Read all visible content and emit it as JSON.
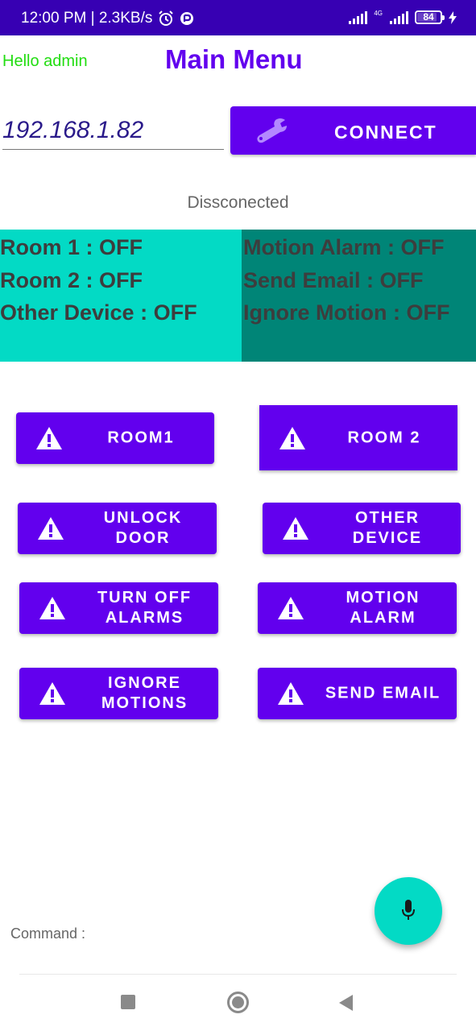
{
  "status_bar": {
    "time_speed": "12:00 PM | 2.3KB/s",
    "net_label": "4G",
    "battery": "84"
  },
  "header": {
    "greeting": "Hello admin",
    "title": "Main Menu"
  },
  "connection": {
    "ip_value": "192.168.1.82",
    "connect_label": "CONNECT",
    "status": "Dissconected"
  },
  "states": {
    "left": [
      "Room 1 : OFF",
      "Room 2 : OFF",
      "Other Device : OFF"
    ],
    "right": [
      "Motion Alarm : OFF",
      "Send Email : OFF",
      "Ignore Motion : OFF"
    ]
  },
  "buttons": {
    "room1": "ROOM1",
    "room2": "ROOM 2",
    "unlock_door": [
      "UNLOCK",
      "DOOR"
    ],
    "other_device": [
      "OTHER",
      "DEVICE"
    ],
    "turn_off_alarms": [
      "TURN OFF",
      "ALARMS"
    ],
    "motion_alarm": [
      "MOTION",
      "ALARM"
    ],
    "ignore_motions": [
      "IGNORE",
      "MOTIONS"
    ],
    "send_email": "SEND EMAIL"
  },
  "command": {
    "label": "Command :"
  },
  "colors": {
    "primary": "#6200ee",
    "status_bar": "#3700b3",
    "teal_light": "#03dac5",
    "teal_dark": "#008577",
    "greeting_green": "#22dd11"
  },
  "icons": [
    "alarm-clock-icon",
    "app-notification-icon",
    "signal-icon",
    "battery-icon",
    "charging-icon",
    "wrench-icon",
    "warning-icon",
    "microphone-icon",
    "nav-recents-icon",
    "nav-home-icon",
    "nav-back-icon"
  ]
}
